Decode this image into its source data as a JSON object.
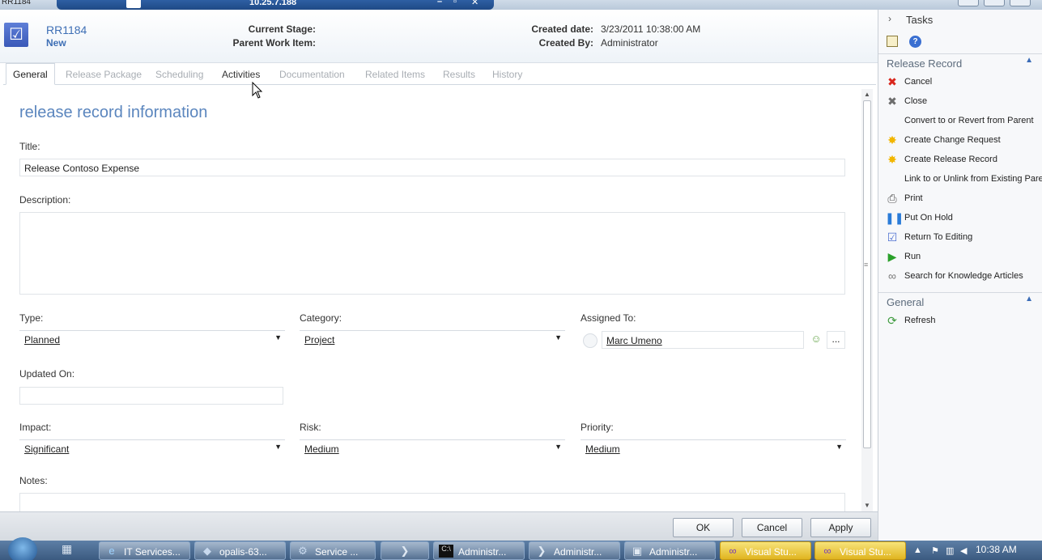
{
  "window": {
    "title": "RR1184",
    "remote_title": "10.25.7.188"
  },
  "header": {
    "id": "RR1184",
    "status": "New",
    "current_stage_label": "Current Stage:",
    "parent_work_item_label": "Parent Work Item:",
    "created_date_label": "Created date:",
    "created_date_value": "3/23/2011 10:38:00 AM",
    "created_by_label": "Created By:",
    "created_by_value": "Administrator"
  },
  "tabs": [
    {
      "label": "General"
    },
    {
      "label": "Release Package"
    },
    {
      "label": "Scheduling"
    },
    {
      "label": "Activities"
    },
    {
      "label": "Documentation"
    },
    {
      "label": "Related Items"
    },
    {
      "label": "Results"
    },
    {
      "label": "History"
    }
  ],
  "form": {
    "section_title": "release record information",
    "title_label": "Title:",
    "title_value": "Release Contoso Expense",
    "description_label": "Description:",
    "description_value": "",
    "type_label": "Type:",
    "type_value": "Planned",
    "category_label": "Category:",
    "category_value": "Project",
    "assigned_to_label": "Assigned To:",
    "assigned_to_value": "Marc Umeno",
    "updated_on_label": "Updated On:",
    "updated_on_value": "",
    "impact_label": "Impact:",
    "impact_value": "Significant",
    "risk_label": "Risk:",
    "risk_value": "Medium",
    "priority_label": "Priority:",
    "priority_value": "Medium",
    "notes_label": "Notes:",
    "browse_label": "..."
  },
  "buttons": {
    "ok": "OK",
    "cancel": "Cancel",
    "apply": "Apply"
  },
  "tasks_pane": {
    "title": "Tasks",
    "release_record_section": "Release Record",
    "release_record_items": [
      {
        "label": "Cancel",
        "icon": "red-x-icon"
      },
      {
        "label": "Close",
        "icon": "gray-x-icon"
      },
      {
        "label": "Convert to or Revert from Parent",
        "icon": ""
      },
      {
        "label": "Create Change Request",
        "icon": "star-icon"
      },
      {
        "label": "Create Release Record",
        "icon": "star-icon"
      },
      {
        "label": "Link to or Unlink from Existing Parent",
        "icon": ""
      },
      {
        "label": "Print",
        "icon": "printer-icon"
      },
      {
        "label": "Put On Hold",
        "icon": "pause-icon"
      },
      {
        "label": "Return To Editing",
        "icon": "form-icon"
      },
      {
        "label": "Run",
        "icon": "play-icon"
      },
      {
        "label": "Search for Knowledge Articles",
        "icon": "link-icon"
      }
    ],
    "general_section": "General",
    "general_items": [
      {
        "label": "Refresh",
        "icon": "refresh-icon"
      }
    ]
  },
  "taskbar": {
    "items": [
      {
        "label": "IT Services...",
        "icon": "ie-icon"
      },
      {
        "label": "opalis-63...",
        "icon": "app-icon"
      },
      {
        "label": "Service ...",
        "icon": "service-icon"
      },
      {
        "label": "",
        "icon": "powershell-icon"
      },
      {
        "label": "Administr...",
        "icon": "cmd-icon"
      },
      {
        "label": "Administr...",
        "icon": "powershell-icon"
      },
      {
        "label": "Administr...",
        "icon": "console-icon"
      },
      {
        "label": "Visual Stu...",
        "icon": "vs-icon"
      },
      {
        "label": "Visual Stu...",
        "icon": "vs-icon"
      }
    ],
    "clock": "10:38 AM"
  },
  "colors": {
    "accent": "#3e6fb5",
    "section_title": "#5b86be",
    "taskbar": "#3b5a80"
  }
}
